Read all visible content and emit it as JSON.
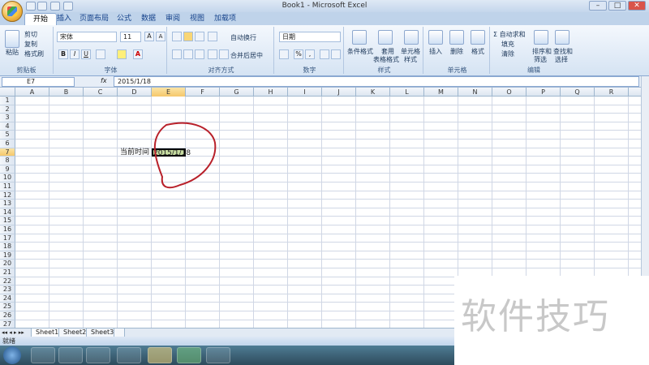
{
  "window": {
    "title": "Book1 - Microsoft Excel",
    "min": "–",
    "max": "□",
    "close": "✕"
  },
  "tabs": [
    "开始",
    "插入",
    "页面布局",
    "公式",
    "数据",
    "审阅",
    "视图",
    "加载项"
  ],
  "ribbon": {
    "clipboard": {
      "paste": "粘贴",
      "cut": "剪切",
      "copy": "复制",
      "format_painter": "格式刷",
      "label": "剪贴板"
    },
    "font": {
      "name": "宋体",
      "size": "11",
      "grow": "A",
      "shrink": "A",
      "bold": "B",
      "italic": "I",
      "underline": "U",
      "label": "字体"
    },
    "alignment": {
      "wrap": "自动换行",
      "merge": "合并后居中",
      "label": "对齐方式"
    },
    "number": {
      "format": "日期",
      "percent": "%",
      "comma": ",",
      "label": "数字"
    },
    "styles": {
      "conditional": "条件格式",
      "table": "套用",
      "table2": "表格格式",
      "cell": "单元格",
      "cell2": "样式",
      "label": "样式"
    },
    "cells": {
      "insert": "插入",
      "delete": "删除",
      "format": "格式",
      "label": "单元格"
    },
    "editing": {
      "autosum": "自动求和",
      "fill": "填充",
      "clear": "清除",
      "sort": "排序和",
      "sort2": "筛选",
      "find": "查找和",
      "find2": "选择",
      "label": "编辑"
    }
  },
  "formula_bar": {
    "name_box": "E7",
    "fx": "fx",
    "value": "2015/1/18"
  },
  "columns": [
    "A",
    "B",
    "C",
    "D",
    "E",
    "F",
    "G",
    "H",
    "I",
    "J",
    "K",
    "L",
    "M",
    "N",
    "O",
    "P",
    "Q",
    "R"
  ],
  "selected_column": "E",
  "selected_row": "7",
  "rows": [
    "1",
    "2",
    "3",
    "4",
    "5",
    "6",
    "7",
    "8",
    "9",
    "10",
    "11",
    "12",
    "13",
    "14",
    "15",
    "16",
    "17",
    "18",
    "19",
    "20",
    "21",
    "22",
    "23",
    "24",
    "25",
    "26",
    "27"
  ],
  "cells": {
    "D7": "当前时间",
    "E7": "2015/1/18"
  },
  "sheets": [
    "Sheet1",
    "Sheet2",
    "Sheet3"
  ],
  "status": "就绪",
  "watermark": "软件技巧",
  "colors": {
    "annotation": "#b8202a",
    "selection": "#c6dba0"
  }
}
